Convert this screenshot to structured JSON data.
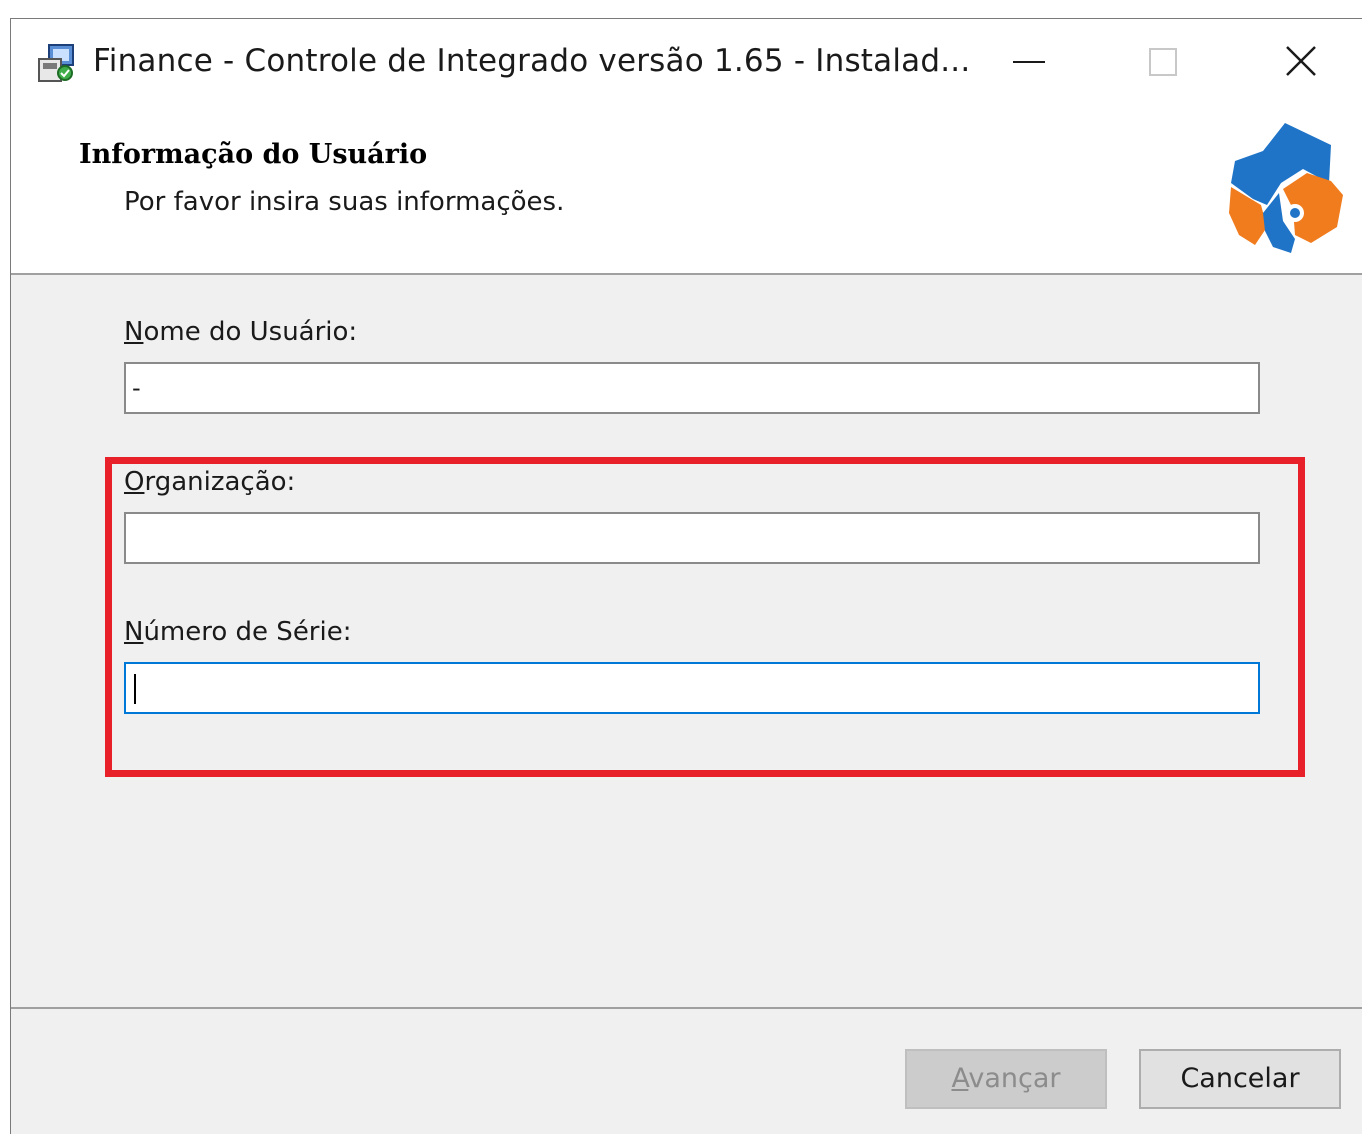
{
  "window": {
    "title": "Finance - Controle de Integrado versão 1.65 - Instalad...",
    "controls": {
      "minimize": "minimize-icon",
      "maximize": "maximize-icon",
      "close": "close-icon"
    }
  },
  "header": {
    "title": "Informação do Usuário",
    "subtitle": "Por favor insira suas informações."
  },
  "form": {
    "user_name": {
      "label_accel": "N",
      "label_rest": "ome do Usuário:",
      "value": "-"
    },
    "organization": {
      "label_accel": "O",
      "label_rest": "rganização:",
      "value": ""
    },
    "serial_number": {
      "label_accel": "N",
      "label_rest": "úmero de Série:",
      "value": ""
    }
  },
  "buttons": {
    "next_accel": "A",
    "next_rest": "vançar",
    "cancel": "Cancelar"
  },
  "colors": {
    "highlight": "#e8202a",
    "focus_border": "#0078d7",
    "logo_blue": "#1f74c8",
    "logo_orange": "#f07c1e"
  }
}
